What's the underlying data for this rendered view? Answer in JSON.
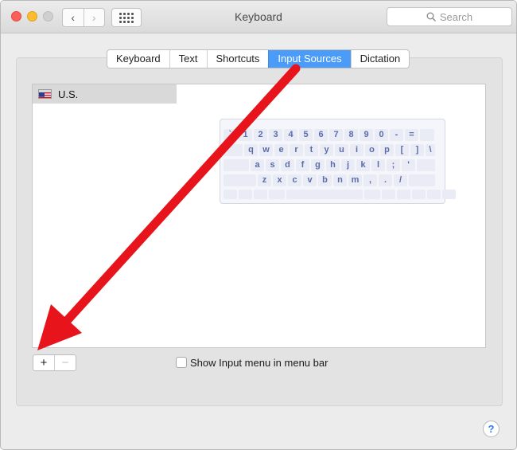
{
  "window": {
    "title": "Keyboard"
  },
  "toolbar": {
    "back": "‹",
    "forward": "›"
  },
  "search": {
    "placeholder": "Search"
  },
  "tabs": [
    {
      "label": "Keyboard",
      "active": false
    },
    {
      "label": "Text",
      "active": false
    },
    {
      "label": "Shortcuts",
      "active": false
    },
    {
      "label": "Input Sources",
      "active": true
    },
    {
      "label": "Dictation",
      "active": false
    }
  ],
  "sources": [
    {
      "label": "U.S.",
      "selected": true
    }
  ],
  "keyboard_rows": [
    [
      "`",
      "1",
      "2",
      "3",
      "4",
      "5",
      "6",
      "7",
      "8",
      "9",
      "0",
      "-",
      "=",
      ""
    ],
    [
      "",
      "q",
      "w",
      "e",
      "r",
      "t",
      "y",
      "u",
      "i",
      "o",
      "p",
      "[",
      "]",
      "\\"
    ],
    [
      "",
      "a",
      "s",
      "d",
      "f",
      "g",
      "h",
      "j",
      "k",
      "l",
      ";",
      "'",
      ""
    ],
    [
      "",
      "z",
      "x",
      "c",
      "v",
      "b",
      "n",
      "m",
      ",",
      ".",
      "/",
      ""
    ],
    [
      "",
      "",
      "",
      "",
      "",
      "",
      "",
      "",
      "",
      "",
      "",
      ""
    ]
  ],
  "buttons": {
    "add": "+",
    "remove": "−"
  },
  "options": {
    "show_input_menu": "Show Input menu in menu bar",
    "show_input_menu_checked": false
  },
  "help": "?",
  "colors": {
    "accent": "#4a9cf8",
    "arrow": "#e8141c"
  }
}
